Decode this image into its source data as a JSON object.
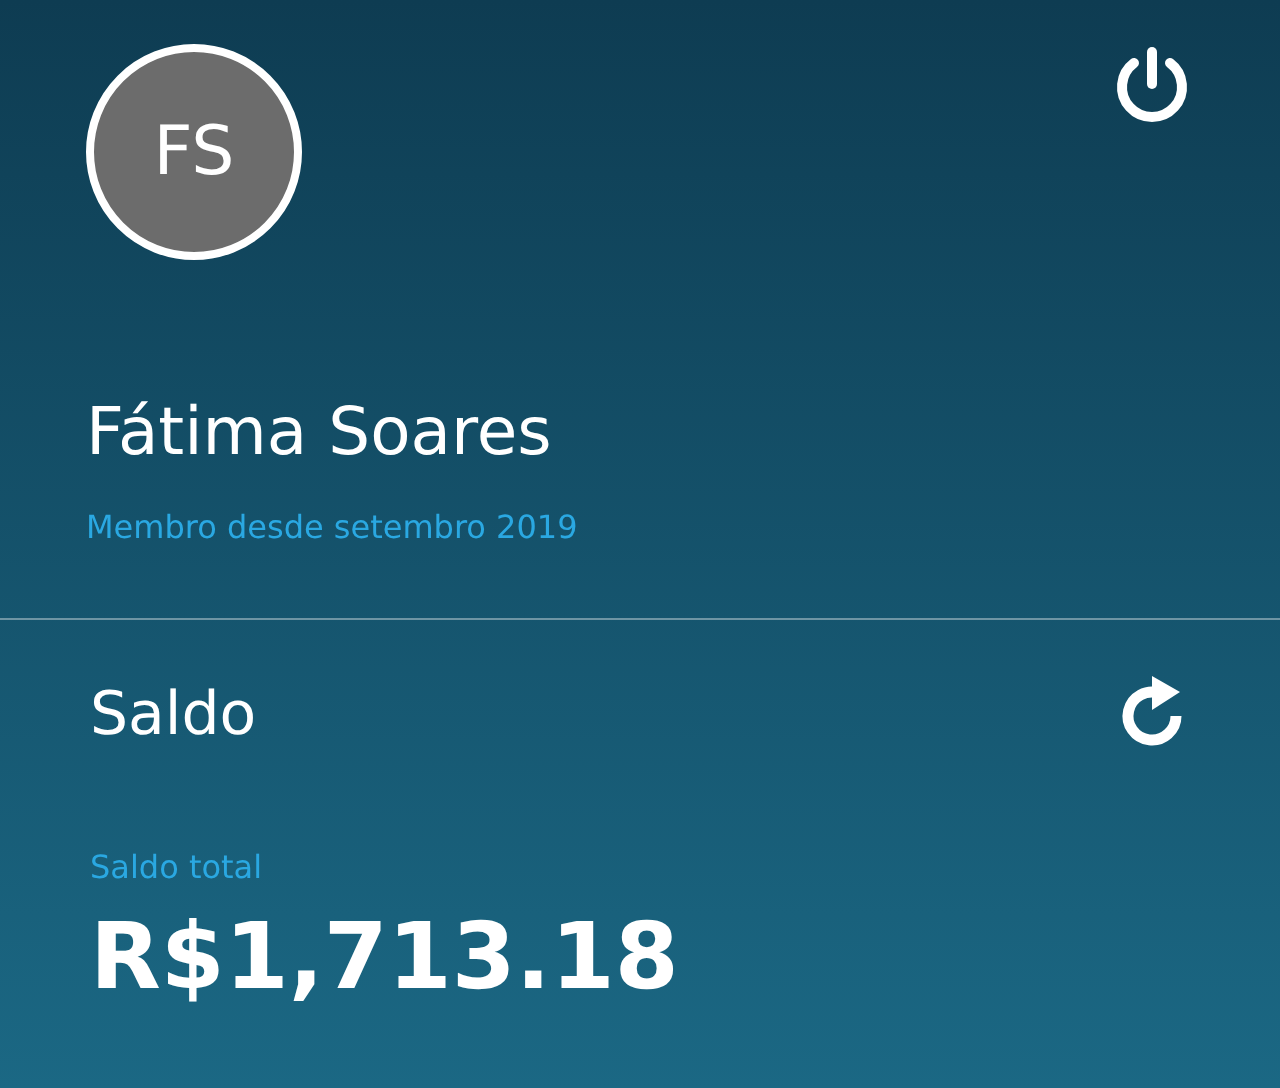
{
  "profile": {
    "initials": "FS",
    "name": "Fátima Soares",
    "member_since": "Membro desde setembro 2019"
  },
  "balance": {
    "title": "Saldo",
    "label": "Saldo total",
    "amount": "R$1,713.18"
  }
}
